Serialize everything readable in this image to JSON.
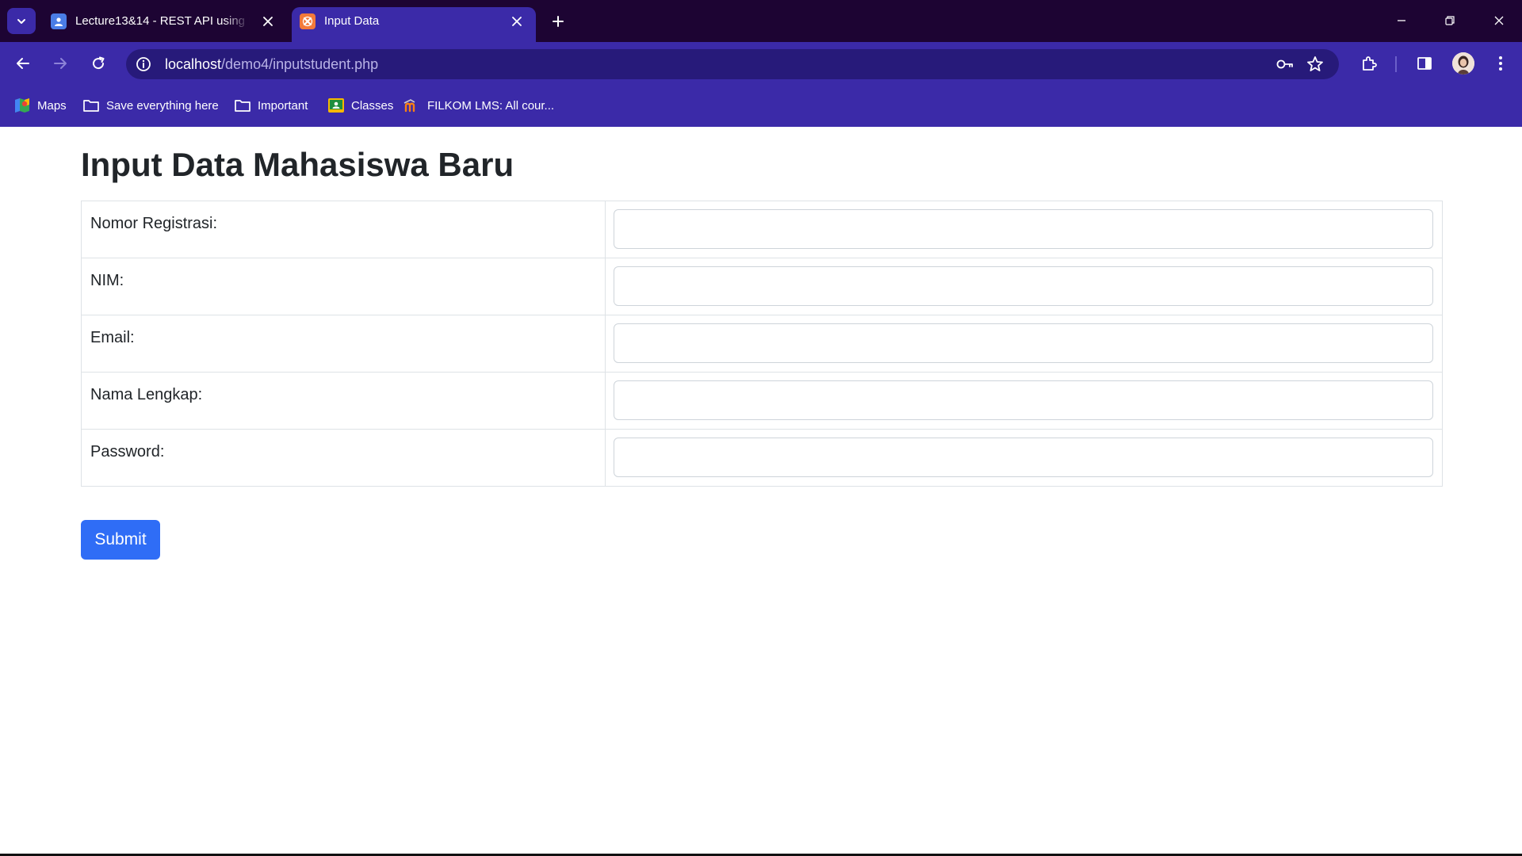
{
  "browser": {
    "tabs": [
      {
        "title": "Lecture13&14 - REST API using Fra",
        "favicon": "classroom-icon",
        "active": false
      },
      {
        "title": "Input Data",
        "favicon": "xampp-icon",
        "active": true
      }
    ],
    "url": {
      "host": "localhost",
      "path": "/demo4/inputstudent.php"
    },
    "bookmarks": [
      {
        "label": "Maps",
        "icon": "maps-icon"
      },
      {
        "label": "Save everything here",
        "icon": "folder-icon"
      },
      {
        "label": "Important",
        "icon": "folder-icon"
      },
      {
        "label": "Classes",
        "icon": "classroom-icon"
      },
      {
        "label": "FILKOM LMS: All cour...",
        "icon": "moodle-icon"
      }
    ],
    "colors": {
      "tabstrip": "#1d0433",
      "toolbar": "#3b2aa8",
      "omnibox": "#271a7a"
    }
  },
  "page": {
    "title": "Input Data Mahasiswa Baru",
    "fields": [
      {
        "label": "Nomor Registrasi:",
        "value": ""
      },
      {
        "label": "NIM:",
        "value": ""
      },
      {
        "label": "Email:",
        "value": ""
      },
      {
        "label": "Nama Lengkap:",
        "value": ""
      },
      {
        "label": "Password:",
        "value": ""
      }
    ],
    "submit_label": "Submit",
    "colors": {
      "submit": "#2f6df6",
      "text": "#212529"
    }
  }
}
